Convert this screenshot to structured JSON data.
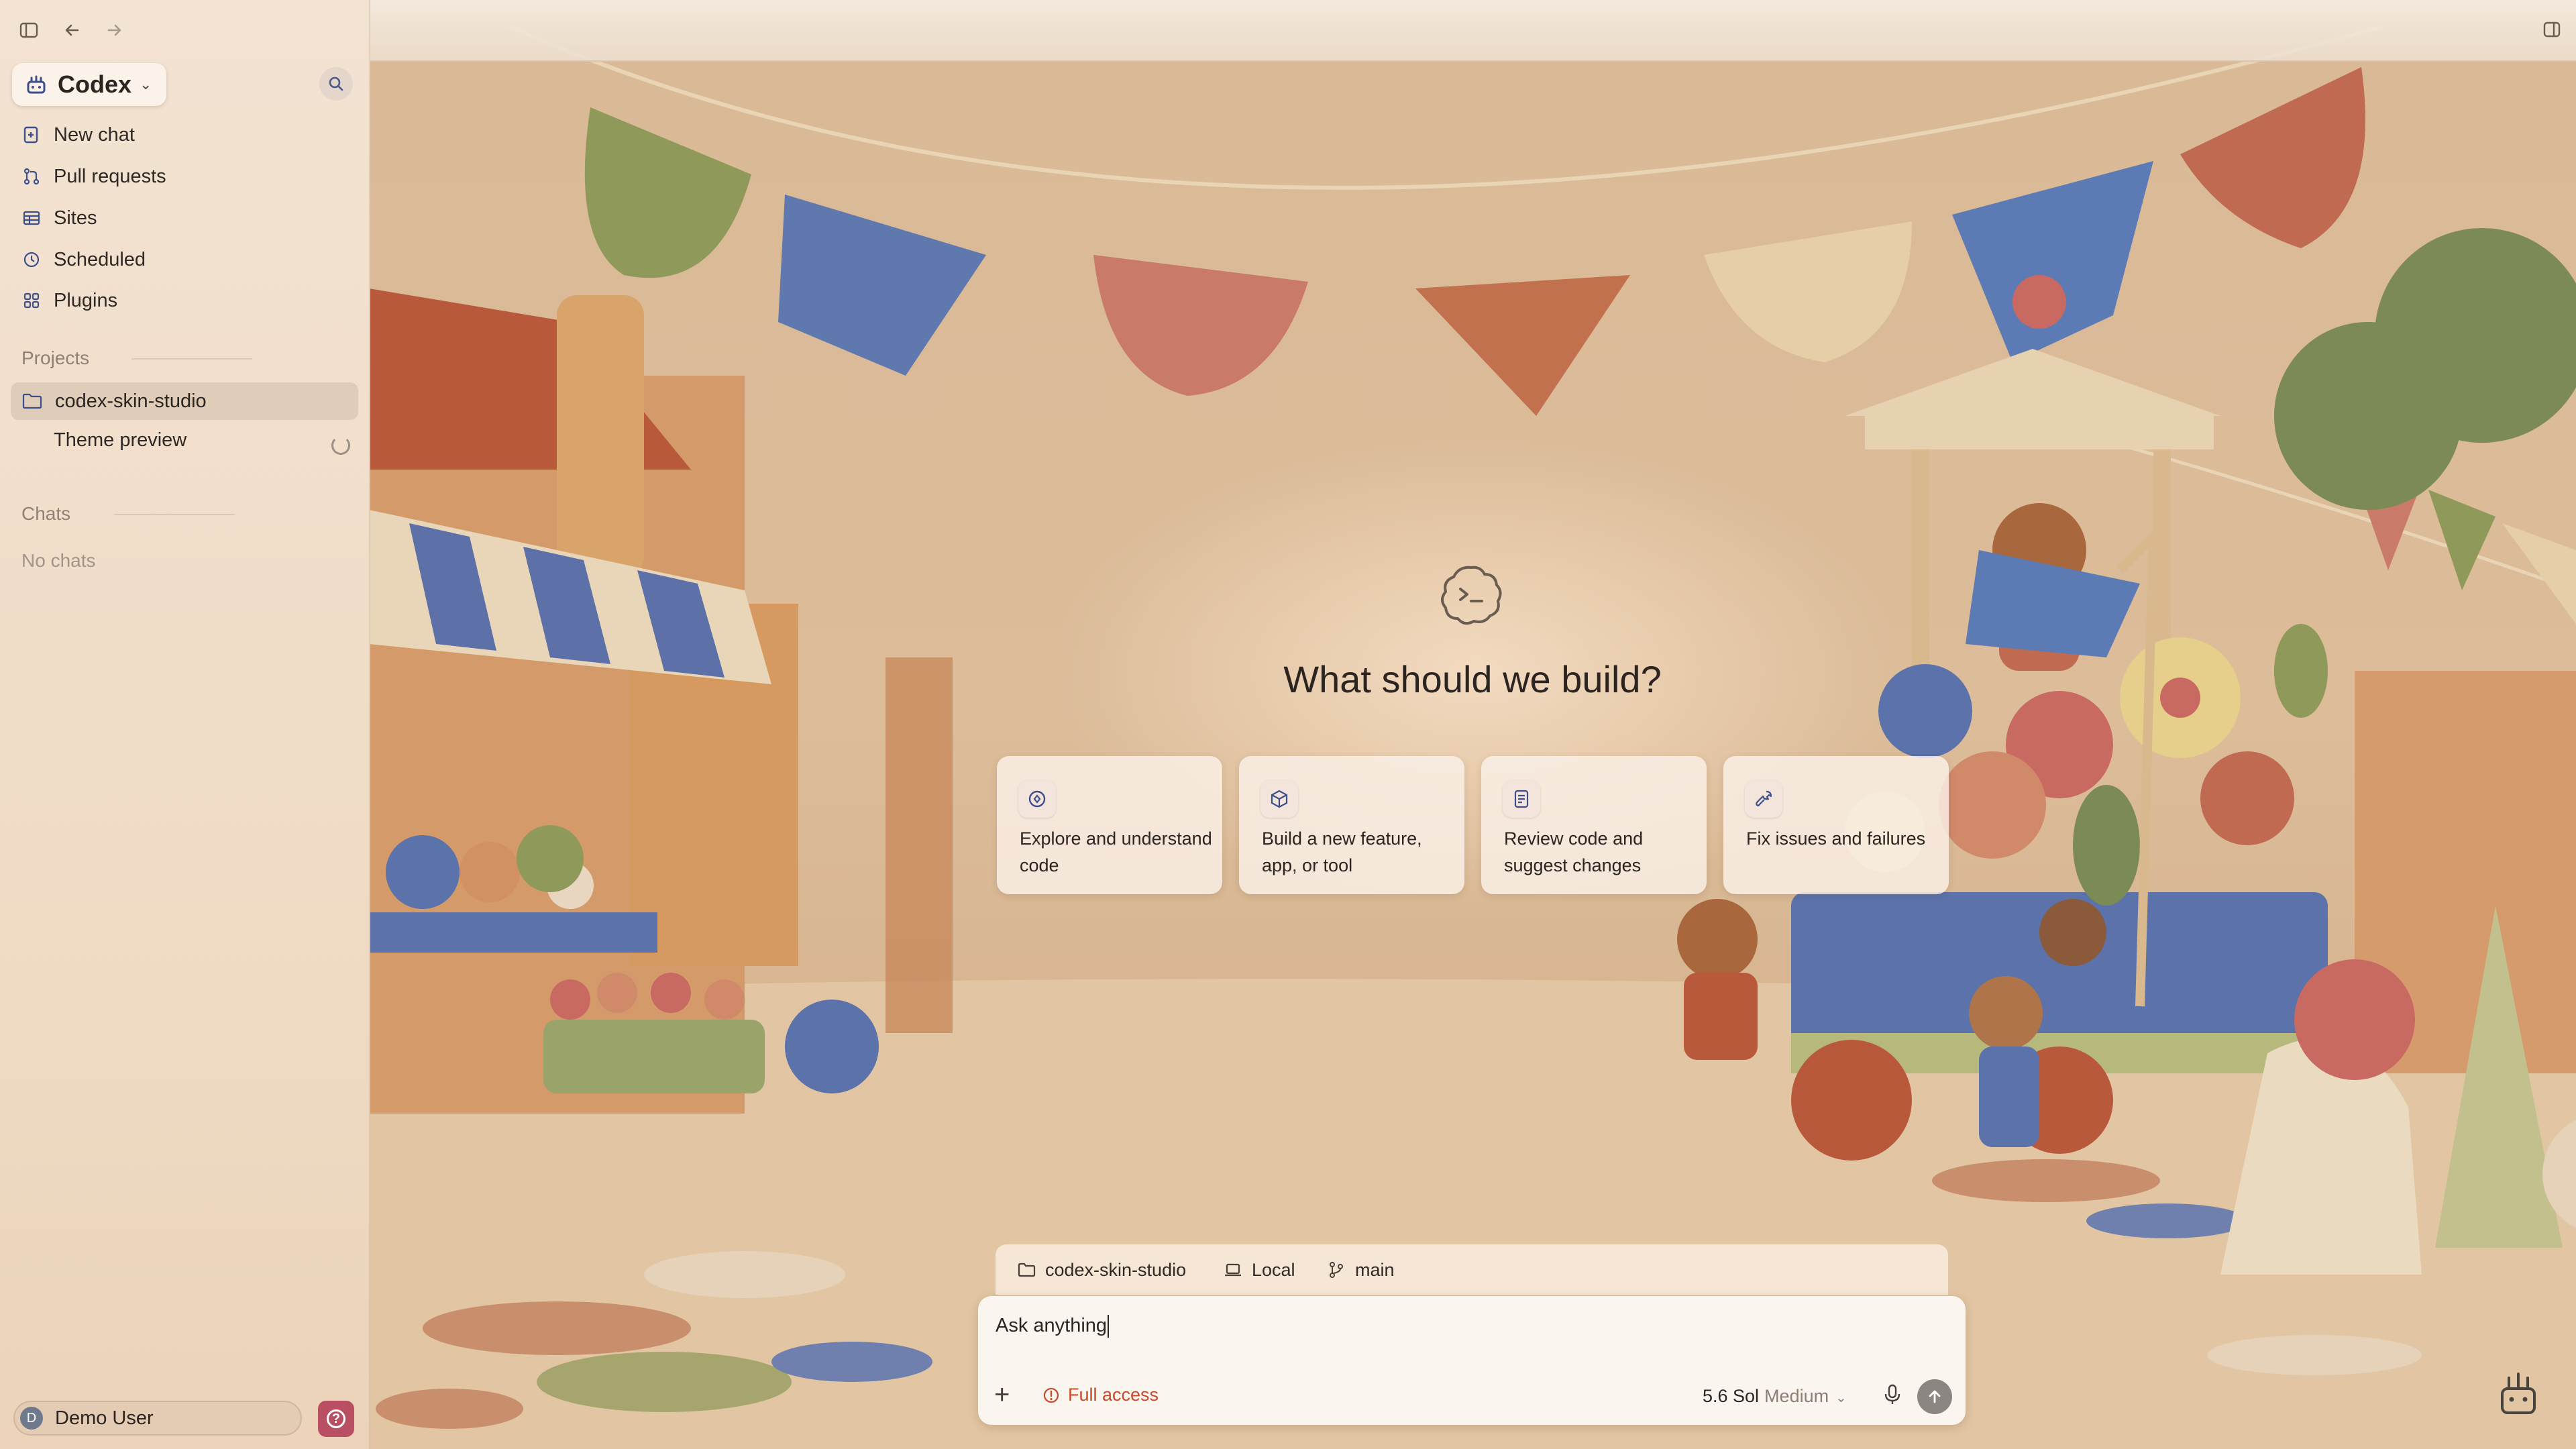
{
  "app": {
    "name": "Codex",
    "accent_color": "#b94f63",
    "warning_color": "#c84a2a"
  },
  "window_controls": {
    "sidebar_toggle_icon": "sidebar-toggle-icon",
    "back_icon": "arrow-left-icon",
    "forward_icon": "arrow-right-icon",
    "panel_toggle_icon": "panel-icon"
  },
  "sidebar": {
    "nav": [
      {
        "label": "New chat",
        "icon": "new-chat-icon"
      },
      {
        "label": "Pull requests",
        "icon": "pull-request-icon"
      },
      {
        "label": "Sites",
        "icon": "sites-icon"
      },
      {
        "label": "Scheduled",
        "icon": "clock-icon"
      },
      {
        "label": "Plugins",
        "icon": "plugin-icon"
      }
    ],
    "projects_label": "Projects",
    "project": {
      "name": "codex-skin-studio",
      "icon": "folder-icon"
    },
    "thread": {
      "label": "Theme preview",
      "status": "loading"
    },
    "chats_label": "Chats",
    "chats_empty": "No chats",
    "user": {
      "initial": "D",
      "name": "Demo User"
    }
  },
  "main": {
    "title": "What should we build?",
    "cards": [
      {
        "label": "Explore and understand code",
        "icon": "explore-icon"
      },
      {
        "label": "Build a new feature, app, or tool",
        "icon": "cube-icon"
      },
      {
        "label": "Review code and suggest changes",
        "icon": "document-icon"
      },
      {
        "label": "Fix issues and failures",
        "icon": "wrench-icon"
      }
    ]
  },
  "composer": {
    "context": {
      "project": "codex-skin-studio",
      "environment": "Local",
      "branch": "main"
    },
    "input_value": "Ask anything",
    "access_label": "Full access",
    "model": "5.6 Sol",
    "effort": "Medium"
  }
}
